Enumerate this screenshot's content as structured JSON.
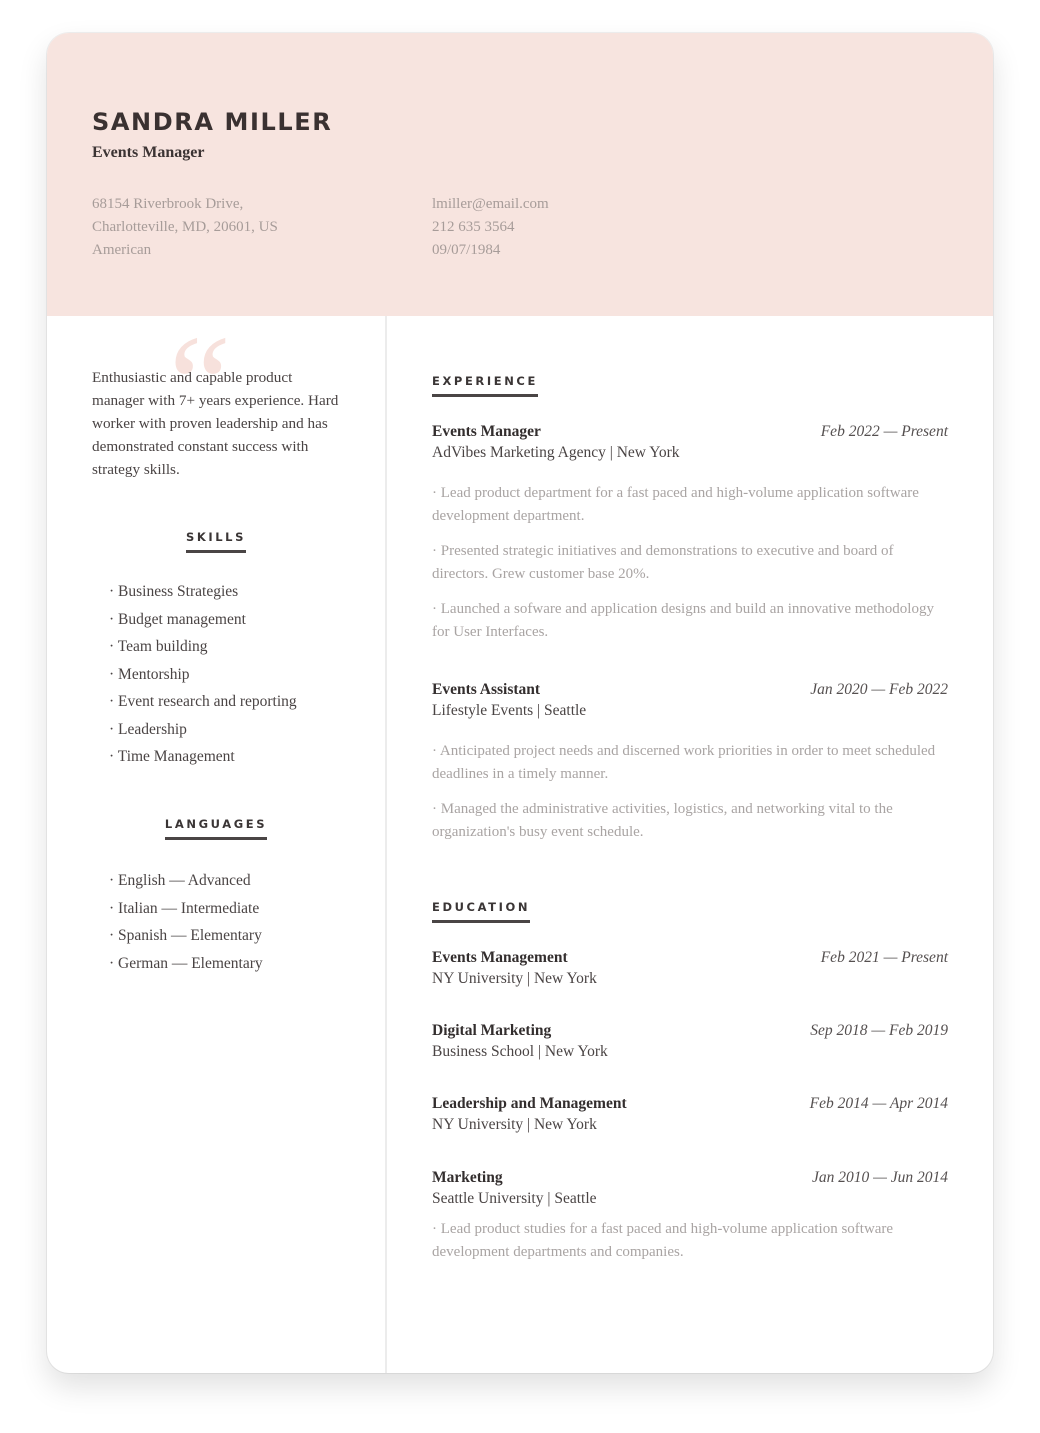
{
  "header": {
    "name": "SANDRA MILLER",
    "role": "Events Manager",
    "address_line1": "68154 Riverbrook Drive,",
    "address_line2": "Charlotteville, MD, 20601, US",
    "nationality": "American",
    "email": "lmiller@email.com",
    "phone": "212 635 3564",
    "birthdate": "09/07/1984"
  },
  "colors": {
    "header_bg": "#f7e4df",
    "quote_mark": "#f6dcd6"
  },
  "sidebar": {
    "quote_icon": "quote-mark-icon",
    "summary": "Enthusiastic and capable product manager with 7+ years experience. Hard worker with proven leadership and has demonstrated constant success with strategy skills.",
    "skills_heading": "SKILLS",
    "skills": [
      "Business Strategies",
      "Budget management",
      "Team building",
      "Mentorship",
      "Event research and reporting",
      "Leadership",
      "Time Management"
    ],
    "languages_heading": "LANGUAGES",
    "languages": [
      "English — Advanced",
      "Italian — Intermediate",
      "Spanish — Elementary",
      "German — Elementary"
    ]
  },
  "experience": {
    "heading": "EXPERIENCE",
    "items": [
      {
        "title": "Events Manager",
        "date": "Feb 2022 — Present",
        "org": "AdVibes Marketing Agency | New York",
        "bullets": [
          "· Lead product department for a fast paced and high-volume application software development department.",
          "· Presented strategic initiatives and demonstrations to executive and board of directors. Grew customer base 20%.",
          "· Launched a sofware and application designs and build an innovative methodology for User Interfaces."
        ]
      },
      {
        "title": "Events Assistant",
        "date": "Jan 2020 — Feb 2022",
        "org": "Lifestyle Events | Seattle",
        "bullets": [
          "· Anticipated project needs and discerned work priorities in order to meet scheduled deadlines in a timely manner.",
          "· Managed the administrative activities, logistics, and networking vital to the organization's busy event schedule."
        ]
      }
    ]
  },
  "education": {
    "heading": "EDUCATION",
    "items": [
      {
        "title": "Events Management",
        "date": "Feb 2021 — Present",
        "org": "NY University | New York"
      },
      {
        "title": "Digital Marketing",
        "date": "Sep 2018 — Feb 2019",
        "org": "Business School | New York"
      },
      {
        "title": "Leadership and Management",
        "date": "Feb 2014 — Apr 2014",
        "org": "NY University | New York"
      },
      {
        "title": "Marketing",
        "date": "Jan 2010 — Jun 2014",
        "org": "Seattle University | Seattle",
        "bullets": [
          "· Lead product studies for a fast paced and high-volume application software development departments and companies."
        ]
      }
    ]
  }
}
